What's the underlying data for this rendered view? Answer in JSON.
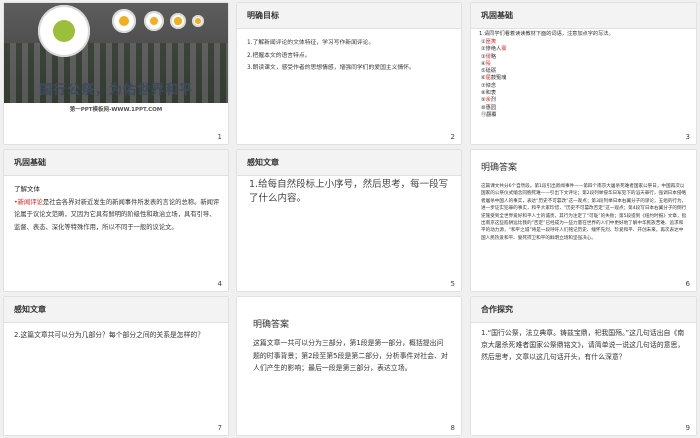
{
  "slides": {
    "s1": {
      "title": "国行公祭，为佑世界和平",
      "site": "第一PPT模板网-WWW.1PPT.COM",
      "num": "1"
    },
    "s2": {
      "header": "明确目标",
      "goals": [
        "1.了解新闻评论的文体特征，学习写作新闻评论。",
        "2.把握本文的语言特点。",
        "3.朗读课文，感受作者的思想情感，增强同学们的爱国主义情怀。"
      ],
      "num": "2"
    },
    "s3": {
      "header": "巩固基础",
      "intro": "1.请同学们看着读读教材下面的词语，注意加点字的写法。",
      "words": [
        {
          "prefix": "①",
          "pre": "",
          "red": "匪夷",
          "post": ""
        },
        {
          "prefix": "②",
          "pre": "惨绝人",
          "red": "寰",
          "post": ""
        },
        {
          "prefix": "③",
          "pre": "",
          "red": "侵",
          "post": "略"
        },
        {
          "prefix": "④",
          "pre": "",
          "red": "殁",
          "post": ""
        },
        {
          "prefix": "⑤",
          "pre": "",
          "red": "",
          "post": "砥砺"
        },
        {
          "prefix": "⑥",
          "pre": "",
          "red": "屈",
          "post": "鼓冤魂"
        },
        {
          "prefix": "⑦",
          "pre": "",
          "red": "",
          "post": "悼念"
        },
        {
          "prefix": "⑧",
          "pre": "",
          "red": "",
          "post": "和衷"
        },
        {
          "prefix": "⑨",
          "pre": "",
          "red": "余",
          "post": "烈"
        },
        {
          "prefix": "⑩",
          "pre": "",
          "red": "",
          "post": "惠园"
        },
        {
          "prefix": "⑪",
          "pre": "",
          "red": "",
          "post": "翻覆"
        }
      ],
      "num": "3"
    },
    "s4": {
      "header": "巩固基础",
      "sub": "了解文体",
      "term": "新闻评论",
      "def": "是社会各界对新近发生的新闻事件所发表的言论的总称。新闻评论属于议论文范畴，又因为它具有鲜明的阶级性和政治立场，具有引导、监督、表态、深化等特殊作用，所以不同于一般的议论文。",
      "num": "4"
    },
    "s5": {
      "header": "感知文章",
      "task": "1.给每自然段标上小序号，然后思考，每一段写了什么内容。",
      "num": "5"
    },
    "s6": {
      "header": "明确答案",
      "text": "这篇课文共分6个自然段。第1段引出新闻事件——第四个南京大屠杀死难者国家公祭日，中国再次以国家的公祭仪式缅念同胞死难——引出下文评论；第2段列举侵华日军犯下的滔天罪行，强调日本侵略者屠杀中国人的事实，表达“历史不可篡改”这一观点；第3段列举日本右翼分子的谬论，五组的行为，进一步证实犯罪的事实，和平大家珍惜，“历史不可篡改否定”这一观点；第4段写日本右翼分子的倒行逆施受到全世界爱好和平人士的谴责，其行为注定了“可耻”的失败；第5段提到《纽约时报》文章，指出南京这些陷阱远比我的“否定”已经成为一些力量在世界的人们中更好地了解中华民族苦难、追求和平的动力源，“和平之城”将是一段呼吁人们铭记历史、缅怀先烈、珍爱和平、开创未来，再次表达中国人民热爱和平、誓死捍卫和平的鲜明立场和坚强决心。",
      "num": "6"
    },
    "s7": {
      "header": "感知文章",
      "q": "2.这篇文章共可以分为几部分？每个部分之间的关系是怎样的？",
      "num": "7"
    },
    "s8": {
      "header": "明确答案",
      "text": "这篇文章一共可以分为三部分，第1段是第一部分，概括提出问题的时事背景；第2段至第5段是第二部分，分析事件对社会、对人们产生的影响；最后一段是第三部分，表达立场。",
      "num": "8"
    },
    "s9": {
      "header": "合作探究",
      "text": "1.“国行公祭，法立典章。铸兹宝鼎，祀我国殇。”这几句话出自《南京大屠杀死难者国家公祭鼎铭文》，请简单说一说这几句话的意思，然后思考，文章以这几句话开头，有什么深意？",
      "num": "9"
    }
  },
  "colors": {
    "accent_red": "#d6211c"
  }
}
